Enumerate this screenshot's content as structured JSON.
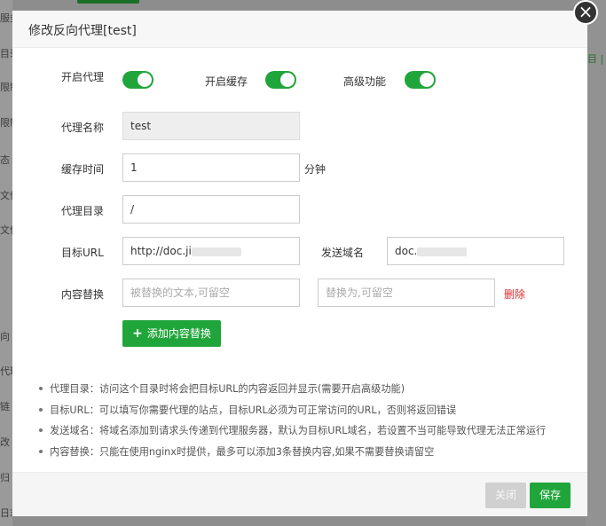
{
  "background": {
    "side_items": [
      "服务",
      "目录",
      "限制",
      "限制",
      "态",
      "文件",
      "文件",
      "向",
      "代理",
      "链",
      "改",
      "归",
      "日志"
    ],
    "right_items": [
      "目 |"
    ]
  },
  "modal": {
    "title": "修改反向代理[test]",
    "close_glyph": "×",
    "toggles": [
      {
        "label": "开启代理",
        "on": true
      },
      {
        "label": "开启缓存",
        "on": true
      },
      {
        "label": "高级功能",
        "on": true
      }
    ],
    "fields": {
      "name": {
        "label": "代理名称",
        "value": "test"
      },
      "cache_time": {
        "label": "缓存时间",
        "value": "1",
        "unit": "分钟"
      },
      "proxy_dir": {
        "label": "代理目录",
        "value": "/"
      },
      "target_url": {
        "label": "目标URL",
        "value": "http://doc.ji"
      },
      "send_domain": {
        "label": "发送域名",
        "value": "doc."
      },
      "content_replace": {
        "label": "内容替换",
        "from_placeholder": "被替换的文本,可留空",
        "to_placeholder": "替换为,可留空",
        "delete_label": "删除"
      }
    },
    "add_button": {
      "icon": "+",
      "label": "添加内容替换"
    },
    "notes": [
      "代理目录：访问这个目录时将会把目标URL的内容返回并显示(需要开启高级功能)",
      "目标URL：可以填写你需要代理的站点，目标URL必须为可正常访问的URL，否则将返回错误",
      "发送域名：将域名添加到请求头传递到代理服务器，默认为目标URL域名，若设置不当可能导致代理无法正常运行",
      "内容替换：只能在使用nginx时提供，最多可以添加3条替换内容,如果不需要替换请留空"
    ],
    "footer": {
      "close_label": "关闭",
      "save_label": "保存"
    }
  },
  "colors": {
    "accent": "#20a53a",
    "danger": "#e02a2a",
    "disabled_button": "#d0d0d0"
  }
}
